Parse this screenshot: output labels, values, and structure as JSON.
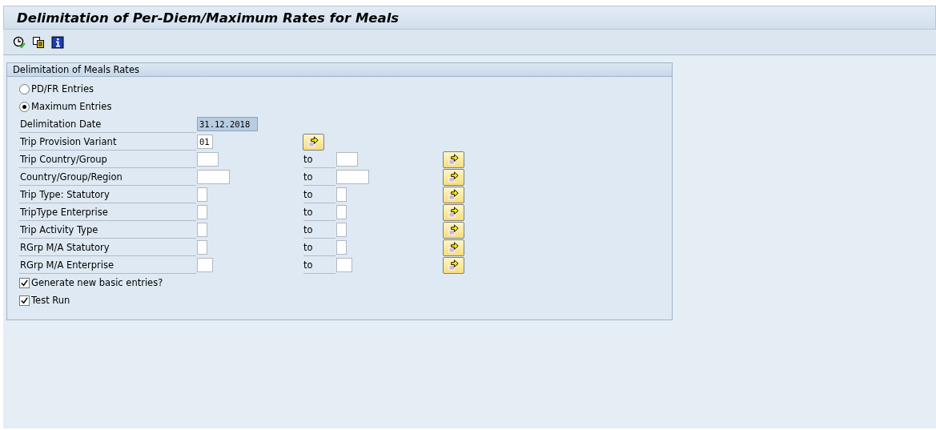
{
  "window": {
    "title": "Delimitation of Per-Diem/Maximum Rates for Meals"
  },
  "group": {
    "title": "Delimitation of Meals Rates",
    "radios": [
      {
        "label": "PD/FR Entries",
        "selected": false
      },
      {
        "label": "Maximum Entries",
        "selected": true
      }
    ],
    "fields": [
      {
        "kind": "date",
        "label": "Delimitation Date",
        "value": "31.12.2018"
      },
      {
        "kind": "single",
        "label": "Trip Provision Variant",
        "value": "01"
      },
      {
        "kind": "range",
        "label": "Trip Country/Group",
        "to": "to"
      },
      {
        "kind": "range",
        "label": "Country/Group/Region",
        "to": "to"
      },
      {
        "kind": "range",
        "label": "Trip Type: Statutory",
        "to": "to"
      },
      {
        "kind": "range",
        "label": "TripType Enterprise",
        "to": "to"
      },
      {
        "kind": "range",
        "label": "Trip Activity Type",
        "to": "to"
      },
      {
        "kind": "range",
        "label": "RGrp M/A Statutory",
        "to": "to"
      },
      {
        "kind": "range",
        "label": "RGrp M/A Enterprise",
        "to": "to"
      }
    ],
    "checkboxes": [
      {
        "label": "Generate new basic entries?",
        "checked": true
      },
      {
        "label": "Test Run",
        "checked": true
      }
    ]
  }
}
